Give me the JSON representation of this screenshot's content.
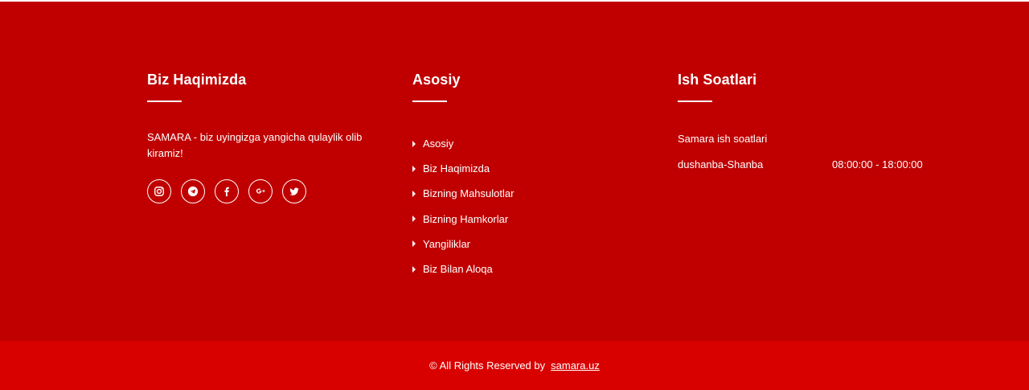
{
  "about": {
    "title": "Biz Haqimizda",
    "text": "SAMARA - biz uyingizga yangicha qulaylik olib kiramiz!",
    "socials": [
      {
        "icon": "instagram-icon"
      },
      {
        "icon": "telegram-icon"
      },
      {
        "icon": "facebook-icon"
      },
      {
        "icon": "google-plus-icon"
      },
      {
        "icon": "twitter-icon"
      }
    ]
  },
  "links": {
    "title": "Asosiy",
    "items": [
      {
        "label": "Asosiy"
      },
      {
        "label": "Biz Haqimizda"
      },
      {
        "label": "Bizning Mahsulotlar"
      },
      {
        "label": "Bizning Hamkorlar"
      },
      {
        "label": "Yangiliklar"
      },
      {
        "label": "Biz Bilan Aloqa"
      }
    ]
  },
  "hours": {
    "title": "Ish Soatlari",
    "subtitle": "Samara ish soatlari",
    "day": "dushanba-Shanba",
    "time": "08:00:00 - 18:00:00"
  },
  "bottom": {
    "rights": "© All Rights Reserved by",
    "link": "samara.uz"
  },
  "colors": {
    "footer_bg": "#c00000",
    "bottom_bar_bg": "#d90000",
    "text": "#ffffff"
  }
}
